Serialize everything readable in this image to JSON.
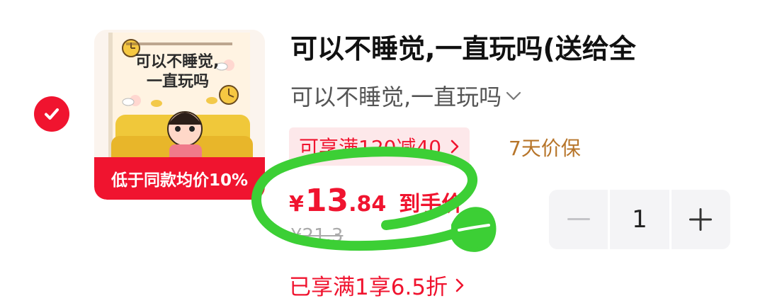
{
  "product": {
    "selected": true,
    "image": {
      "cover_title_line1": "可以不睡觉,",
      "cover_title_line2": "一直玩吗",
      "badge": "低于同款均价10%"
    },
    "title": "可以不睡觉,一直玩吗(送给全",
    "variant": "可以不睡觉,一直玩吗",
    "coupon": "可享满120减40",
    "guarantee": "7天价保",
    "price": {
      "currency": "¥",
      "integer": "13",
      "decimal": ".84",
      "label": "到手价"
    },
    "original_price": "¥21.3",
    "discount": "已享满1享6.5折",
    "quantity": "1"
  },
  "colors": {
    "accent": "#f0142f",
    "annotation": "#3ccf35",
    "guarantee": "#b7752a"
  },
  "icons": [
    "check-icon",
    "chevron-down-icon",
    "chevron-right-icon",
    "minus-icon",
    "plus-icon"
  ]
}
